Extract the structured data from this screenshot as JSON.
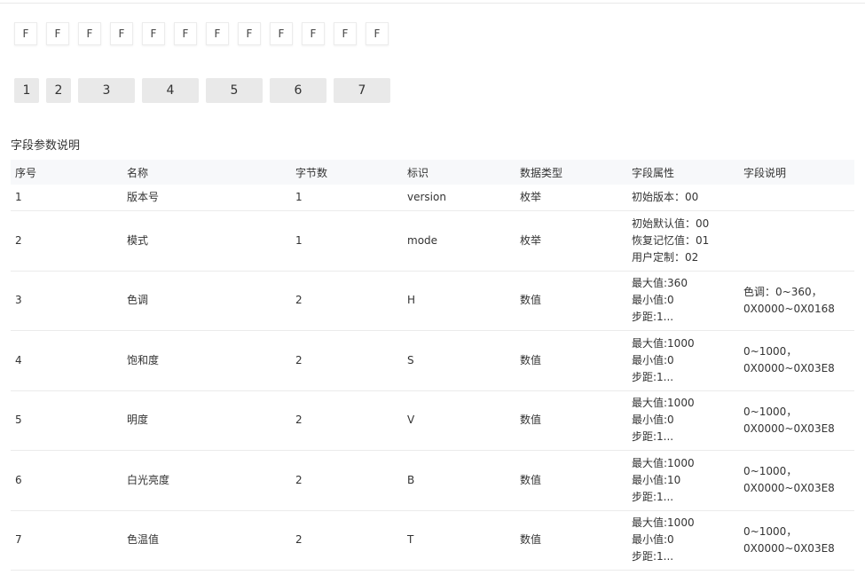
{
  "hex_boxes": [
    "F",
    "F",
    "F",
    "F",
    "F",
    "F",
    "F",
    "F",
    "F",
    "F",
    "F",
    "F"
  ],
  "segments": [
    "1",
    "2",
    "3",
    "4",
    "5",
    "6",
    "7"
  ],
  "section_title": "字段参数说明",
  "table": {
    "headers": [
      "序号",
      "名称",
      "字节数",
      "标识",
      "数据类型",
      "字段属性",
      "字段说明"
    ],
    "rows": [
      {
        "no": "1",
        "name": "版本号",
        "bytes": "1",
        "id": "version",
        "type": "枚举",
        "attrs": [
          "初始版本：00"
        ],
        "desc": []
      },
      {
        "no": "2",
        "name": "模式",
        "bytes": "1",
        "id": "mode",
        "type": "枚举",
        "attrs": [
          "初始默认值：00",
          "恢复记忆值：01",
          "用户定制：02"
        ],
        "desc": []
      },
      {
        "no": "3",
        "name": "色调",
        "bytes": "2",
        "id": "H",
        "type": "数值",
        "attrs": [
          "最大值:360",
          "最小值:0",
          "步距:1..."
        ],
        "desc": [
          "色调：0~360，",
          "0X0000~0X0168"
        ]
      },
      {
        "no": "4",
        "name": "饱和度",
        "bytes": "2",
        "id": "S",
        "type": "数值",
        "attrs": [
          "最大值:1000",
          "最小值:0",
          "步距:1..."
        ],
        "desc": [
          "0~1000，",
          "0X0000~0X03E8"
        ]
      },
      {
        "no": "5",
        "name": "明度",
        "bytes": "2",
        "id": "V",
        "type": "数值",
        "attrs": [
          "最大值:1000",
          "最小值:0",
          "步距:1..."
        ],
        "desc": [
          "0~1000，",
          "0X0000~0X03E8"
        ]
      },
      {
        "no": "6",
        "name": "白光亮度",
        "bytes": "2",
        "id": "B",
        "type": "数值",
        "attrs": [
          "最大值:1000",
          "最小值:10",
          "步距:1..."
        ],
        "desc": [
          "0~1000，",
          "0X0000~0X03E8"
        ]
      },
      {
        "no": "7",
        "name": "色温值",
        "bytes": "2",
        "id": "T",
        "type": "数值",
        "attrs": [
          "最大值:1000",
          "最小值:0",
          "步距:1..."
        ],
        "desc": [
          "0~1000，",
          "0X0000~0X03E8"
        ]
      }
    ]
  }
}
